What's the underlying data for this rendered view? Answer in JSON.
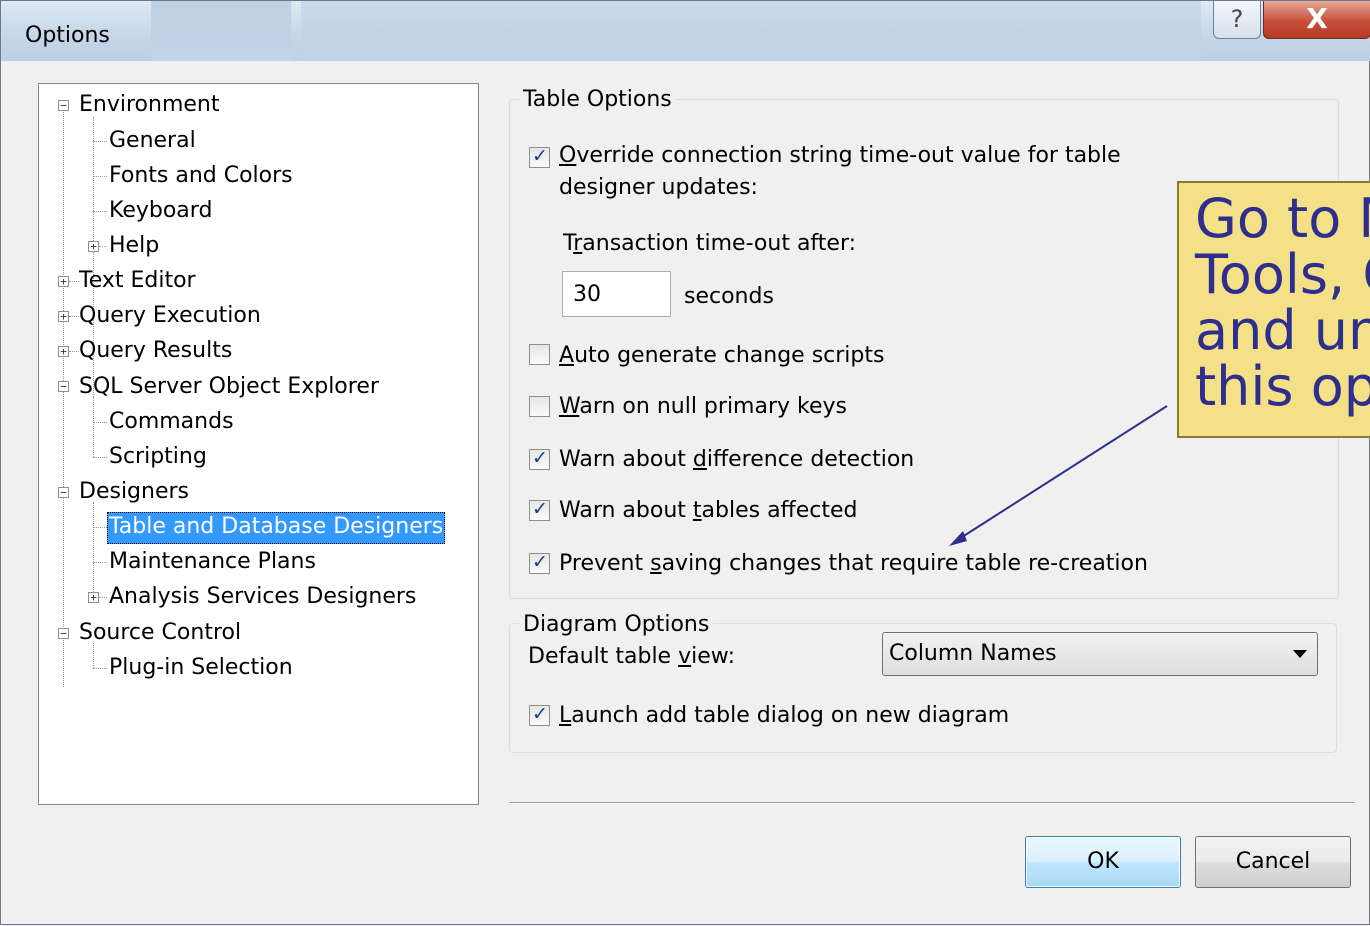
{
  "window": {
    "title": "Options",
    "help_glyph": "?",
    "close_glyph": "X"
  },
  "tree": {
    "environment": "Environment",
    "general": "General",
    "fonts_colors": "Fonts and Colors",
    "keyboard": "Keyboard",
    "help": "Help",
    "text_editor": "Text Editor",
    "query_execution": "Query Execution",
    "query_results": "Query Results",
    "ssoe": "SQL Server Object Explorer",
    "commands": "Commands",
    "scripting": "Scripting",
    "designers": "Designers",
    "table_db_designers": "Table and Database Designers",
    "maintenance_plans": "Maintenance Plans",
    "analysis_services": "Analysis Services Designers",
    "source_control": "Source Control",
    "plugin_selection": "Plug-in Selection"
  },
  "table_options": {
    "title": "Table Options",
    "override_line1_mn": "O",
    "override_line1_rest": "verride connection string time-out value for table",
    "override_line2": "designer updates:",
    "override_checked": true,
    "transaction_label_pre": "T",
    "transaction_label_mn": "r",
    "transaction_label_rest": "ansaction time-out after:",
    "timeout_value": "30",
    "seconds": "seconds",
    "auto_generate_mn": "A",
    "auto_generate_rest": "uto generate change scripts",
    "auto_generate_checked": false,
    "warn_null_mn": "W",
    "warn_null_rest": "arn on null primary keys",
    "warn_null_checked": false,
    "warn_diff_pre": "Warn about ",
    "warn_diff_mn": "d",
    "warn_diff_rest": "ifference detection",
    "warn_diff_checked": true,
    "warn_tables_pre": "Warn about ",
    "warn_tables_mn": "t",
    "warn_tables_rest": "ables affected",
    "warn_tables_checked": true,
    "prevent_pre": "Prevent ",
    "prevent_mn": "s",
    "prevent_rest": "aving changes that require table re-creation",
    "prevent_checked": true
  },
  "diagram_options": {
    "title": "Diagram Options",
    "default_view_pre": "Default table ",
    "default_view_mn": "v",
    "default_view_rest": "iew:",
    "default_view_value": "Column Names",
    "launch_mn": "L",
    "launch_rest": "aunch add table dialog on new diagram",
    "launch_checked": true
  },
  "buttons": {
    "ok": "OK",
    "cancel": "Cancel"
  },
  "callout": {
    "line1": "Go to M",
    "line2": "Tools, O",
    "line3": "and un",
    "line4": "this op"
  },
  "colors": {
    "selection": "#3399ff",
    "callout_bg": "#f4e086",
    "callout_text": "#2e2e8f",
    "close_red": "#c7503a"
  }
}
